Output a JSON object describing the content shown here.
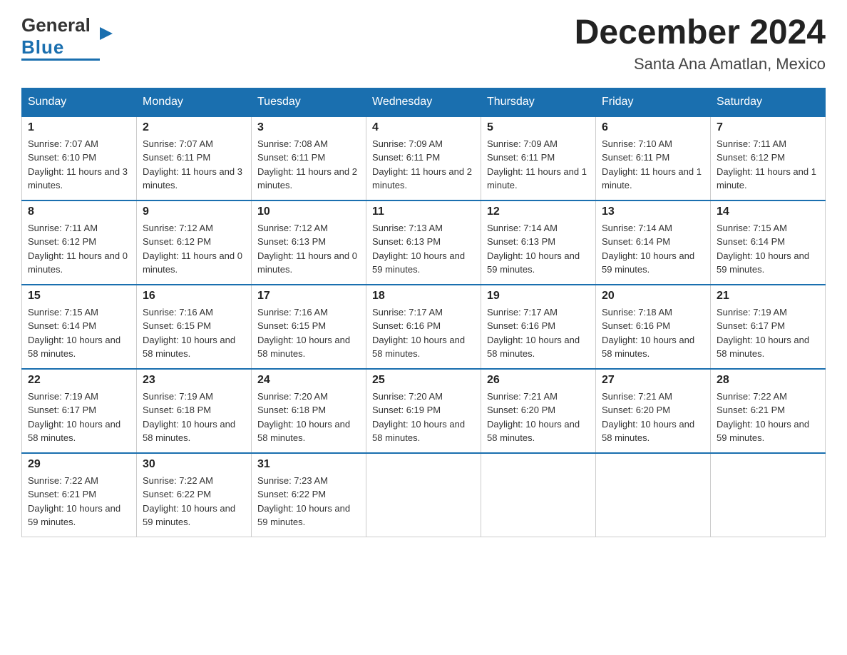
{
  "header": {
    "logo": {
      "line1": "General",
      "triangle": "▶",
      "line2": "Blue"
    },
    "month_title": "December 2024",
    "location": "Santa Ana Amatlan, Mexico"
  },
  "weekdays": [
    "Sunday",
    "Monday",
    "Tuesday",
    "Wednesday",
    "Thursday",
    "Friday",
    "Saturday"
  ],
  "weeks": [
    [
      {
        "day": "1",
        "sunrise": "Sunrise: 7:07 AM",
        "sunset": "Sunset: 6:10 PM",
        "daylight": "Daylight: 11 hours and 3 minutes."
      },
      {
        "day": "2",
        "sunrise": "Sunrise: 7:07 AM",
        "sunset": "Sunset: 6:11 PM",
        "daylight": "Daylight: 11 hours and 3 minutes."
      },
      {
        "day": "3",
        "sunrise": "Sunrise: 7:08 AM",
        "sunset": "Sunset: 6:11 PM",
        "daylight": "Daylight: 11 hours and 2 minutes."
      },
      {
        "day": "4",
        "sunrise": "Sunrise: 7:09 AM",
        "sunset": "Sunset: 6:11 PM",
        "daylight": "Daylight: 11 hours and 2 minutes."
      },
      {
        "day": "5",
        "sunrise": "Sunrise: 7:09 AM",
        "sunset": "Sunset: 6:11 PM",
        "daylight": "Daylight: 11 hours and 1 minute."
      },
      {
        "day": "6",
        "sunrise": "Sunrise: 7:10 AM",
        "sunset": "Sunset: 6:11 PM",
        "daylight": "Daylight: 11 hours and 1 minute."
      },
      {
        "day": "7",
        "sunrise": "Sunrise: 7:11 AM",
        "sunset": "Sunset: 6:12 PM",
        "daylight": "Daylight: 11 hours and 1 minute."
      }
    ],
    [
      {
        "day": "8",
        "sunrise": "Sunrise: 7:11 AM",
        "sunset": "Sunset: 6:12 PM",
        "daylight": "Daylight: 11 hours and 0 minutes."
      },
      {
        "day": "9",
        "sunrise": "Sunrise: 7:12 AM",
        "sunset": "Sunset: 6:12 PM",
        "daylight": "Daylight: 11 hours and 0 minutes."
      },
      {
        "day": "10",
        "sunrise": "Sunrise: 7:12 AM",
        "sunset": "Sunset: 6:13 PM",
        "daylight": "Daylight: 11 hours and 0 minutes."
      },
      {
        "day": "11",
        "sunrise": "Sunrise: 7:13 AM",
        "sunset": "Sunset: 6:13 PM",
        "daylight": "Daylight: 10 hours and 59 minutes."
      },
      {
        "day": "12",
        "sunrise": "Sunrise: 7:14 AM",
        "sunset": "Sunset: 6:13 PM",
        "daylight": "Daylight: 10 hours and 59 minutes."
      },
      {
        "day": "13",
        "sunrise": "Sunrise: 7:14 AM",
        "sunset": "Sunset: 6:14 PM",
        "daylight": "Daylight: 10 hours and 59 minutes."
      },
      {
        "day": "14",
        "sunrise": "Sunrise: 7:15 AM",
        "sunset": "Sunset: 6:14 PM",
        "daylight": "Daylight: 10 hours and 59 minutes."
      }
    ],
    [
      {
        "day": "15",
        "sunrise": "Sunrise: 7:15 AM",
        "sunset": "Sunset: 6:14 PM",
        "daylight": "Daylight: 10 hours and 58 minutes."
      },
      {
        "day": "16",
        "sunrise": "Sunrise: 7:16 AM",
        "sunset": "Sunset: 6:15 PM",
        "daylight": "Daylight: 10 hours and 58 minutes."
      },
      {
        "day": "17",
        "sunrise": "Sunrise: 7:16 AM",
        "sunset": "Sunset: 6:15 PM",
        "daylight": "Daylight: 10 hours and 58 minutes."
      },
      {
        "day": "18",
        "sunrise": "Sunrise: 7:17 AM",
        "sunset": "Sunset: 6:16 PM",
        "daylight": "Daylight: 10 hours and 58 minutes."
      },
      {
        "day": "19",
        "sunrise": "Sunrise: 7:17 AM",
        "sunset": "Sunset: 6:16 PM",
        "daylight": "Daylight: 10 hours and 58 minutes."
      },
      {
        "day": "20",
        "sunrise": "Sunrise: 7:18 AM",
        "sunset": "Sunset: 6:16 PM",
        "daylight": "Daylight: 10 hours and 58 minutes."
      },
      {
        "day": "21",
        "sunrise": "Sunrise: 7:19 AM",
        "sunset": "Sunset: 6:17 PM",
        "daylight": "Daylight: 10 hours and 58 minutes."
      }
    ],
    [
      {
        "day": "22",
        "sunrise": "Sunrise: 7:19 AM",
        "sunset": "Sunset: 6:17 PM",
        "daylight": "Daylight: 10 hours and 58 minutes."
      },
      {
        "day": "23",
        "sunrise": "Sunrise: 7:19 AM",
        "sunset": "Sunset: 6:18 PM",
        "daylight": "Daylight: 10 hours and 58 minutes."
      },
      {
        "day": "24",
        "sunrise": "Sunrise: 7:20 AM",
        "sunset": "Sunset: 6:18 PM",
        "daylight": "Daylight: 10 hours and 58 minutes."
      },
      {
        "day": "25",
        "sunrise": "Sunrise: 7:20 AM",
        "sunset": "Sunset: 6:19 PM",
        "daylight": "Daylight: 10 hours and 58 minutes."
      },
      {
        "day": "26",
        "sunrise": "Sunrise: 7:21 AM",
        "sunset": "Sunset: 6:20 PM",
        "daylight": "Daylight: 10 hours and 58 minutes."
      },
      {
        "day": "27",
        "sunrise": "Sunrise: 7:21 AM",
        "sunset": "Sunset: 6:20 PM",
        "daylight": "Daylight: 10 hours and 58 minutes."
      },
      {
        "day": "28",
        "sunrise": "Sunrise: 7:22 AM",
        "sunset": "Sunset: 6:21 PM",
        "daylight": "Daylight: 10 hours and 59 minutes."
      }
    ],
    [
      {
        "day": "29",
        "sunrise": "Sunrise: 7:22 AM",
        "sunset": "Sunset: 6:21 PM",
        "daylight": "Daylight: 10 hours and 59 minutes."
      },
      {
        "day": "30",
        "sunrise": "Sunrise: 7:22 AM",
        "sunset": "Sunset: 6:22 PM",
        "daylight": "Daylight: 10 hours and 59 minutes."
      },
      {
        "day": "31",
        "sunrise": "Sunrise: 7:23 AM",
        "sunset": "Sunset: 6:22 PM",
        "daylight": "Daylight: 10 hours and 59 minutes."
      },
      null,
      null,
      null,
      null
    ]
  ]
}
